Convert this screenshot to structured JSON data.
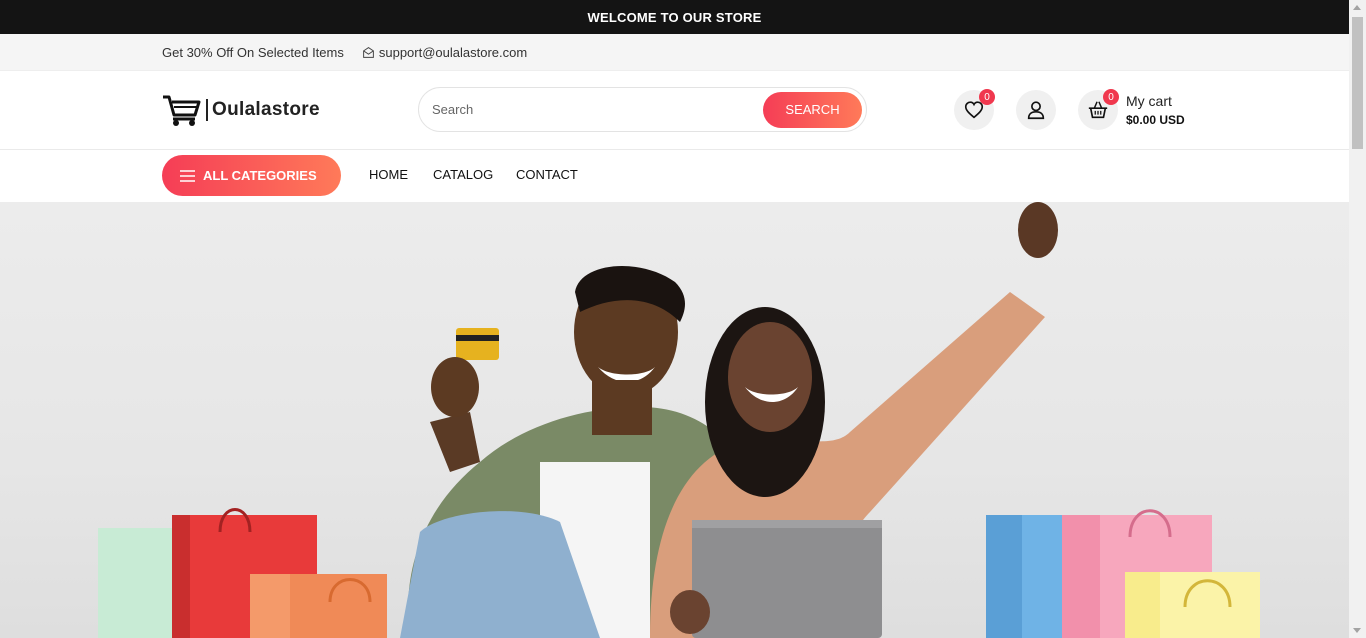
{
  "welcome_bar": {
    "text": "WELCOME TO OUR STORE"
  },
  "info_bar": {
    "promo": "Get 30% Off On Selected Items",
    "email": "support@oulalastore.com",
    "email_icon": "envelope-icon"
  },
  "header": {
    "logo_text": "Oulalastore",
    "logo_icon": "shopping-cart-icon",
    "search": {
      "placeholder": "Search",
      "value": "",
      "button_label": "SEARCH"
    },
    "wishlist": {
      "icon": "heart-icon",
      "count": "0"
    },
    "account": {
      "icon": "user-icon"
    },
    "cart": {
      "icon": "basket-icon",
      "count": "0",
      "label": "My cart",
      "total": "$0.00 USD"
    }
  },
  "nav": {
    "all_categories": {
      "label": "ALL CATEGORIES",
      "icon": "menu-icon"
    },
    "links": [
      {
        "label": "HOME"
      },
      {
        "label": "CATALOG"
      },
      {
        "label": "CONTACT"
      }
    ]
  },
  "hero": {
    "image": "couple-with-shopping-bags-photo"
  },
  "colors": {
    "accent_start": "#f53d56",
    "accent_end": "#ff7a59",
    "top_bar": "#141414",
    "badge": "#f0384e"
  }
}
